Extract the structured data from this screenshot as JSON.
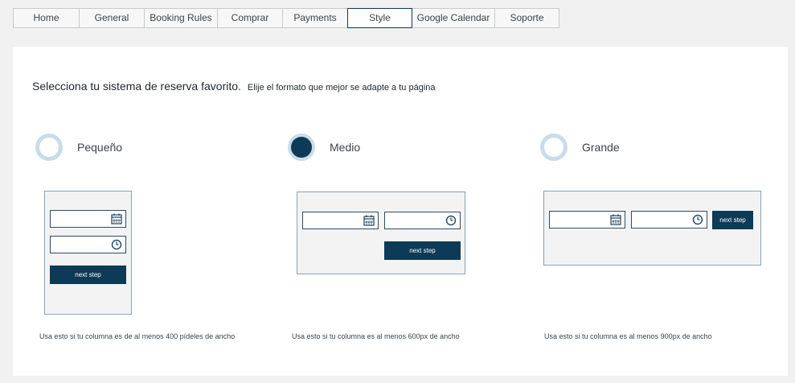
{
  "tabs": [
    {
      "label": "Home"
    },
    {
      "label": "General"
    },
    {
      "label": "Booking Rules"
    },
    {
      "label": "Comprar"
    },
    {
      "label": "Payments"
    },
    {
      "label": "Style"
    },
    {
      "label": "Google Calendar"
    },
    {
      "label": "Soporte"
    }
  ],
  "active_tab": "Style",
  "heading": {
    "title": "Selecciona tu sistema de reserva favorito.",
    "subtitle": "Elije el formato que mejor se adapte a tu página"
  },
  "options": [
    {
      "label": "Pequeño",
      "selected": false,
      "button": "next step",
      "note": "Usa esto si tu columna es de al menos 400 pídeles de ancho"
    },
    {
      "label": "Medio",
      "selected": true,
      "button": "next step",
      "note": "Usa esto si tu columna es al menos 600px de ancho"
    },
    {
      "label": "Grande",
      "selected": false,
      "button": "next step",
      "note": "Usa esto si tu columna es al menos 900px de ancho"
    }
  ],
  "colors": {
    "accent": "#0d3a56",
    "radio_ring": "#c8dcea",
    "background": "#f1f1f1",
    "panel": "#ffffff"
  },
  "icons": {
    "date_field": "calendar-icon",
    "time_field": "clock-icon"
  }
}
